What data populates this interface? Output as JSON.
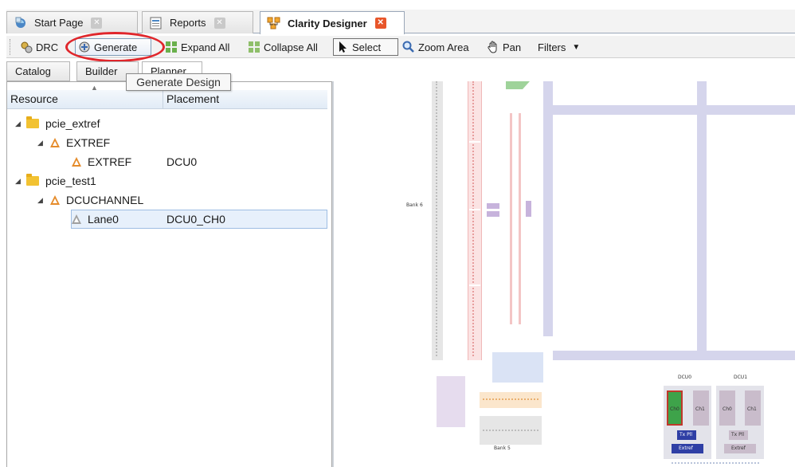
{
  "doc_tabs": [
    {
      "label": "Start Page",
      "active": false
    },
    {
      "label": "Reports",
      "active": false
    },
    {
      "label": "Clarity Designer",
      "active": true
    }
  ],
  "toolbar": {
    "drc": "DRC",
    "generate": "Generate",
    "expand_all": "Expand All",
    "collapse_all": "Collapse All",
    "select": "Select",
    "zoom_area": "Zoom Area",
    "pan": "Pan",
    "filters": "Filters"
  },
  "side_tabs": [
    {
      "label": "Catalog",
      "active": false
    },
    {
      "label": "Builder",
      "active": false
    },
    {
      "label": "Planner",
      "active": true
    }
  ],
  "tooltip": "Generate Design",
  "tree": {
    "columns": {
      "resource": "Resource",
      "placement": "Placement"
    },
    "rows": [
      {
        "label": "pcie_extref",
        "placement": "",
        "level": 0,
        "icon": "folder-icon"
      },
      {
        "label": "EXTREF",
        "placement": "",
        "level": 1,
        "icon": "resource-icon"
      },
      {
        "label": "EXTREF",
        "placement": "DCU0",
        "level": 2,
        "icon": "resource-icon"
      },
      {
        "label": "pcie_test1",
        "placement": "",
        "level": 0,
        "icon": "folder-icon"
      },
      {
        "label": "DCUCHANNEL",
        "placement": "",
        "level": 1,
        "icon": "resource-icon"
      },
      {
        "label": "Lane0",
        "placement": "DCU0_CH0",
        "level": 2,
        "icon": "resource-icon",
        "selected": true
      }
    ]
  },
  "canvas": {
    "bank6": "Bank 6",
    "bank5": "Bank 5",
    "dcu0": "DCU0",
    "dcu1": "DCU1",
    "ch0": "Ch0",
    "ch1": "Ch1",
    "dcu1_ch0": "Ch0",
    "dcu1_ch1": "Ch1",
    "txpll_0": "Tx Pll",
    "txpll_1": "Tx Pll",
    "extref_0": "Extref",
    "extref_1": "Extref"
  },
  "colors": {
    "annotation": "#e0262b",
    "selected_row": "#e7f0fb",
    "routing": "#d5d5ec",
    "dcu_ch0_active": "#3ea34a"
  }
}
